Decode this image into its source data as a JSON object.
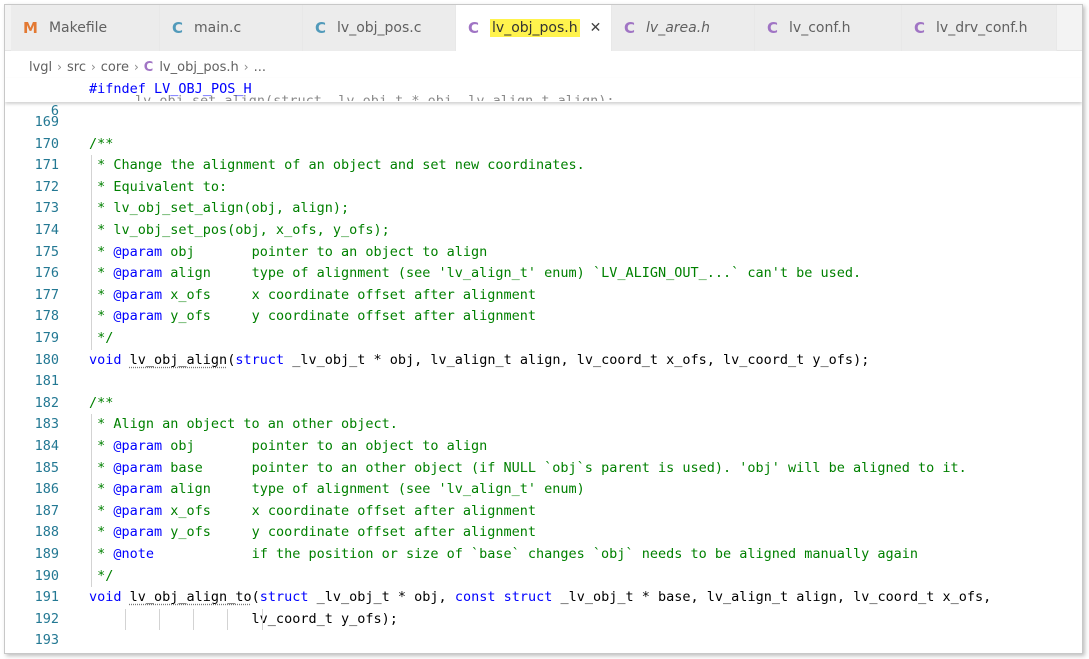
{
  "tabs": [
    {
      "icon": "M",
      "icon_kind": "makefile",
      "label": "Makefile",
      "active": false,
      "italic": false
    },
    {
      "icon": "C",
      "icon_kind": "c-source",
      "label": "main.c",
      "active": false,
      "italic": false
    },
    {
      "icon": "C",
      "icon_kind": "c-source",
      "label": "lv_obj_pos.c",
      "active": false,
      "italic": false
    },
    {
      "icon": "C",
      "icon_kind": "c-header",
      "label": "lv_obj_pos.h",
      "active": true,
      "italic": false,
      "close": "✕"
    },
    {
      "icon": "C",
      "icon_kind": "c-header",
      "label": "lv_area.h",
      "active": false,
      "italic": true
    },
    {
      "icon": "C",
      "icon_kind": "c-header",
      "label": "lv_conf.h",
      "active": false,
      "italic": false
    },
    {
      "icon": "C",
      "icon_kind": "c-header",
      "label": "lv_drv_conf.h",
      "active": false,
      "italic": false
    }
  ],
  "breadcrumb": {
    "parts": [
      "lvgl",
      "src",
      "core"
    ],
    "file_icon": "C",
    "file": "lv_obj_pos.h",
    "tail": "..."
  },
  "sticky": {
    "line_number": "6",
    "directive": "#ifndef",
    "macro": "LV_OBJ_POS_H"
  },
  "lines": [
    {
      "n": "169",
      "text": ""
    },
    {
      "n": "170",
      "text": "/**"
    },
    {
      "n": "171",
      "text": " * Change the alignment of an object and set new coordinates."
    },
    {
      "n": "172",
      "text": " * Equivalent to:"
    },
    {
      "n": "173",
      "text": " * lv_obj_set_align(obj, align);"
    },
    {
      "n": "174",
      "text": " * lv_obj_set_pos(obj, x_ofs, y_ofs);"
    },
    {
      "n": "175",
      "text": " * @param obj       pointer to an object to align"
    },
    {
      "n": "176",
      "text": " * @param align     type of alignment (see 'lv_align_t' enum) `LV_ALIGN_OUT_...` can't be used."
    },
    {
      "n": "177",
      "text": " * @param x_ofs     x coordinate offset after alignment"
    },
    {
      "n": "178",
      "text": " * @param y_ofs     y coordinate offset after alignment"
    },
    {
      "n": "179",
      "text": " */"
    },
    {
      "n": "180",
      "text": "void lv_obj_align(struct _lv_obj_t * obj, lv_align_t align, lv_coord_t x_ofs, lv_coord_t y_ofs);"
    },
    {
      "n": "181",
      "text": ""
    },
    {
      "n": "182",
      "text": "/**"
    },
    {
      "n": "183",
      "text": " * Align an object to an other object."
    },
    {
      "n": "184",
      "text": " * @param obj       pointer to an object to align"
    },
    {
      "n": "185",
      "text": " * @param base      pointer to an other object (if NULL `obj`s parent is used). 'obj' will be aligned to it."
    },
    {
      "n": "186",
      "text": " * @param align     type of alignment (see 'lv_align_t' enum)"
    },
    {
      "n": "187",
      "text": " * @param x_ofs     x coordinate offset after alignment"
    },
    {
      "n": "188",
      "text": " * @param y_ofs     y coordinate offset after alignment"
    },
    {
      "n": "189",
      "text": " * @note            if the position or size of `base` changes `obj` needs to be aligned manually again"
    },
    {
      "n": "190",
      "text": " */"
    },
    {
      "n": "191",
      "text": "void lv_obj_align_to(struct _lv_obj_t * obj, const struct _lv_obj_t * base, lv_align_t align, lv_coord_t x_ofs,"
    },
    {
      "n": "192",
      "text": "                    lv_coord_t y_ofs);"
    },
    {
      "n": "193",
      "text": ""
    }
  ],
  "colors": {
    "keyword": "#0000ff",
    "comment": "#008000",
    "line_number": "#237893",
    "tab_highlight": "#fff34d"
  }
}
